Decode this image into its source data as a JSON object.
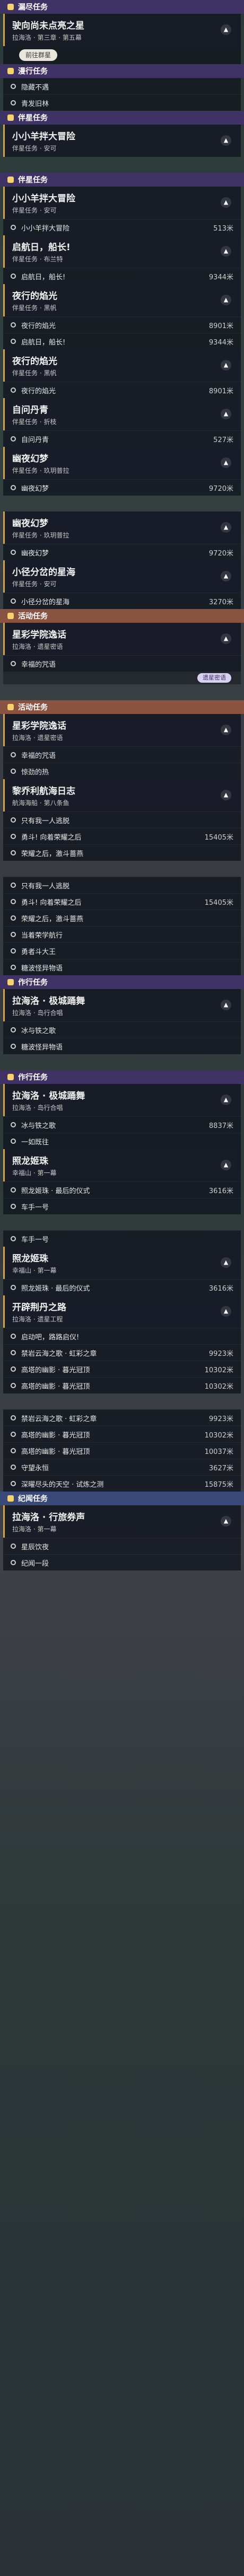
{
  "sections": [
    {
      "type": "header",
      "variant": "quest",
      "label": "漏尽任务"
    },
    {
      "type": "card",
      "title": "驶向尚未点亮之星",
      "sub": "拉海洛 · 第三章 · 第五幕"
    },
    {
      "type": "button",
      "label": "前往群星"
    },
    {
      "type": "header",
      "variant": "quest",
      "label": "漫行任务"
    },
    {
      "type": "row",
      "label": "隐藏不遇",
      "dist": ""
    },
    {
      "type": "row",
      "label": "青发旧林",
      "dist": ""
    },
    {
      "type": "header",
      "variant": "quest",
      "label": "伴星任务"
    },
    {
      "type": "card",
      "title": "小小羊拌大冒险",
      "sub": "伴星任务 · 安可"
    },
    {
      "type": "gap"
    },
    {
      "type": "header",
      "variant": "quest",
      "label": "伴星任务"
    },
    {
      "type": "card",
      "title": "小小羊拌大冒险",
      "sub": "伴星任务 · 安可"
    },
    {
      "type": "row",
      "label": "小小羊拌大冒险",
      "dist": "513米"
    },
    {
      "type": "card",
      "title": "启航日，船长!",
      "sub": "伴星任务 · 布兰特"
    },
    {
      "type": "row",
      "label": "启航日，船长!",
      "dist": "9344米"
    },
    {
      "type": "card",
      "title": "夜行的焰光",
      "sub": "伴星任务 · 黑帆"
    },
    {
      "type": "row",
      "label": "夜行的焰光",
      "dist": "8901米"
    },
    {
      "type": "row",
      "label": "启航日，船长!",
      "dist": "9344米"
    },
    {
      "type": "card",
      "title": "夜行的焰光",
      "sub": "伴星任务 · 黑帆"
    },
    {
      "type": "row",
      "label": "夜行的焰光",
      "dist": "8901米"
    },
    {
      "type": "card",
      "title": "自问丹青",
      "sub": "伴星任务 · 折枝"
    },
    {
      "type": "row",
      "label": "自问丹青",
      "dist": "527米"
    },
    {
      "type": "card",
      "title": "幽夜幻梦",
      "sub": "伴星任务 · 玖玥普拉"
    },
    {
      "type": "row",
      "label": "幽夜幻梦",
      "dist": "9720米"
    },
    {
      "type": "gap"
    },
    {
      "type": "card",
      "title": "幽夜幻梦",
      "sub": "伴星任务 · 玖玥普拉"
    },
    {
      "type": "row",
      "label": "幽夜幻梦",
      "dist": "9720米"
    },
    {
      "type": "card",
      "title": "小径分岔的星海",
      "sub": "伴星任务 · 安可"
    },
    {
      "type": "row",
      "label": "小径分岔的星海",
      "dist": "3270米"
    },
    {
      "type": "header",
      "variant": "event",
      "label": "活动任务"
    },
    {
      "type": "card",
      "title": "星彩学院逸话",
      "sub": "拉海洛 · 遗星密语"
    },
    {
      "type": "row",
      "label": "幸福的咒语",
      "dist": ""
    },
    {
      "type": "tag",
      "label": "遗星密语"
    },
    {
      "type": "gap"
    },
    {
      "type": "header",
      "variant": "event",
      "label": "活动任务"
    },
    {
      "type": "card",
      "title": "星彩学院逸话",
      "sub": "拉海洛 · 遗星密语"
    },
    {
      "type": "row",
      "label": "幸福的咒语",
      "dist": ""
    },
    {
      "type": "row",
      "label": "惊劲的热",
      "dist": ""
    },
    {
      "type": "card",
      "title": "黎乔利航海日志",
      "sub": "航海海船 · 第八条鱼"
    },
    {
      "type": "row",
      "label": "只有我一人逃脱",
      "dist": ""
    },
    {
      "type": "row",
      "label": "勇斗! 向着荣耀之后",
      "dist": "15405米"
    },
    {
      "type": "row",
      "label": "荣耀之后，激斗蔷燕",
      "dist": ""
    },
    {
      "type": "gap"
    },
    {
      "type": "row",
      "label": "只有我一人逃脱",
      "dist": ""
    },
    {
      "type": "row",
      "label": "勇斗! 向着荣耀之后",
      "dist": "15405米"
    },
    {
      "type": "row",
      "label": "荣耀之后，激斗蔷燕",
      "dist": ""
    },
    {
      "type": "row",
      "label": "当着荣学航行",
      "dist": ""
    },
    {
      "type": "row",
      "label": "勇者斗大王",
      "dist": ""
    },
    {
      "type": "row",
      "label": "糖波怪异物语",
      "dist": ""
    },
    {
      "type": "header",
      "variant": "quest",
      "label": "作行任务"
    },
    {
      "type": "card",
      "title": "拉海洛 · 极城踊舞",
      "sub": "拉海洛 · 岛行合唱"
    },
    {
      "type": "row",
      "label": "冰与铁之歌",
      "dist": ""
    },
    {
      "type": "row",
      "label": "糖波怪异物语",
      "dist": ""
    },
    {
      "type": "gap"
    },
    {
      "type": "header",
      "variant": "quest",
      "label": "作行任务"
    },
    {
      "type": "card",
      "title": "拉海洛 · 极城踊舞",
      "sub": "拉海洛 · 岛行合唱"
    },
    {
      "type": "row",
      "label": "冰与铁之歌",
      "dist": "8837米"
    },
    {
      "type": "row",
      "label": "一如既往",
      "dist": ""
    },
    {
      "type": "card",
      "title": "照龙姬珠",
      "sub": "幸福山 · 第一幕"
    },
    {
      "type": "row",
      "label": "照龙姬珠 · 最后的仪式",
      "dist": "3616米"
    },
    {
      "type": "row",
      "label": "车手一号",
      "dist": ""
    },
    {
      "type": "gap"
    },
    {
      "type": "row",
      "label": "车手一号",
      "dist": ""
    },
    {
      "type": "card",
      "title": "照龙姬珠",
      "sub": "幸福山 · 第一幕"
    },
    {
      "type": "row",
      "label": "照龙姬珠 · 最后的仪式",
      "dist": "3616米"
    },
    {
      "type": "card",
      "title": "开辟荆丹之路",
      "sub": "拉海洛 · 遗星工程"
    },
    {
      "type": "row",
      "label": "启动吧，路路启仪!",
      "dist": ""
    },
    {
      "type": "row",
      "label": "禁岩云海之歌 · 虹彩之章",
      "dist": "9923米"
    },
    {
      "type": "row",
      "label": "高塔的幽影 · 暮光冠顶",
      "dist": "10302米"
    },
    {
      "type": "row",
      "label": "高塔的幽影 · 暮光冠顶",
      "dist": "10302米"
    },
    {
      "type": "gap"
    },
    {
      "type": "row",
      "label": "禁岩云海之歌 · 虹彩之章",
      "dist": "9923米"
    },
    {
      "type": "row",
      "label": "高塔的幽影 · 暮光冠顶",
      "dist": "10302米"
    },
    {
      "type": "row",
      "label": "高塔的幽影 · 暮光冠顶",
      "dist": "10037米"
    },
    {
      "type": "row",
      "label": "守望永恒",
      "dist": "3627米"
    },
    {
      "type": "row",
      "label": "深曜尽头的天空 · 试炼之测",
      "dist": "15875米"
    },
    {
      "type": "header",
      "variant": "invite",
      "label": "纪闻任务"
    },
    {
      "type": "card",
      "title": "拉海洛 · 行旅券声",
      "sub": "拉海洛 · 第一幕"
    },
    {
      "type": "row",
      "label": "星辰饮夜",
      "dist": ""
    },
    {
      "type": "row",
      "label": "纪闻一段",
      "dist": ""
    }
  ]
}
